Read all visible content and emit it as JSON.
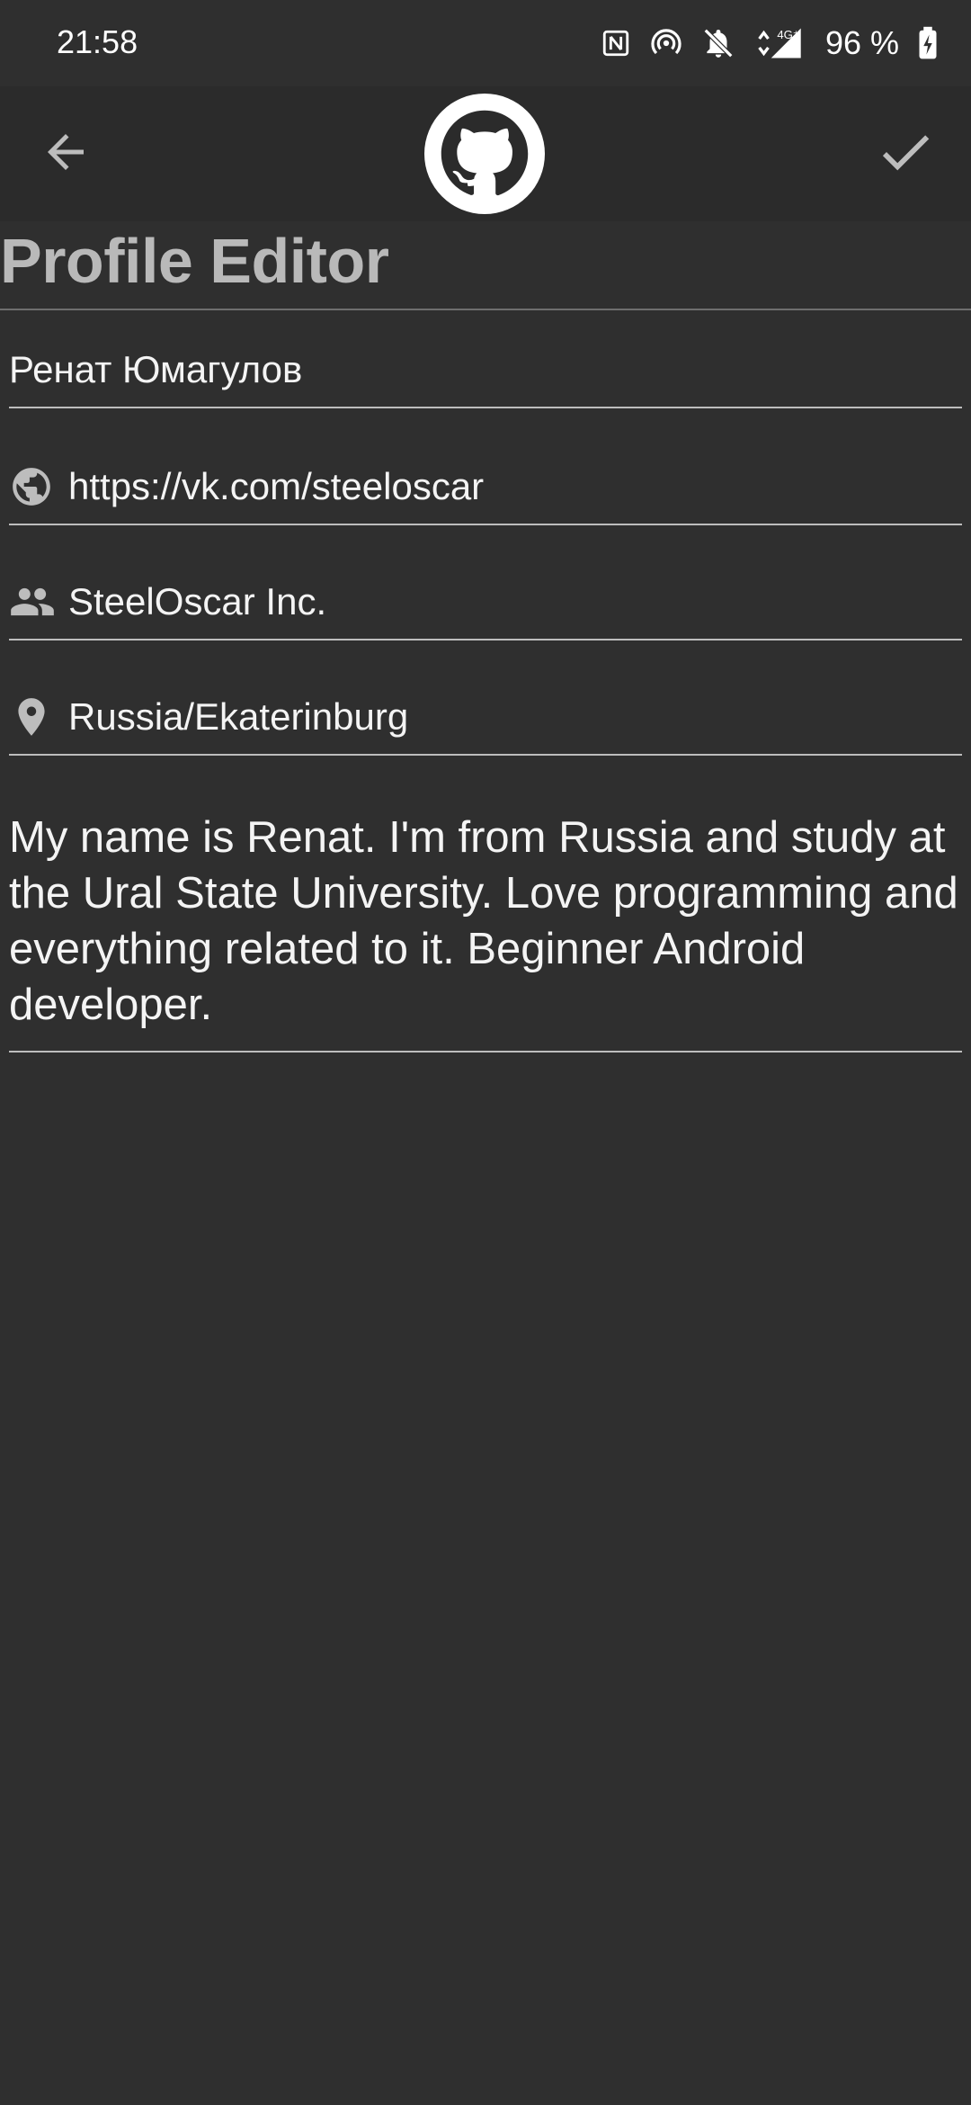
{
  "status_bar": {
    "time": "21:58",
    "network": "4G⁺",
    "battery_percent": "96 %",
    "icons": [
      "nfc-icon",
      "hotspot-icon",
      "bell-off-icon",
      "data-arrows-icon",
      "signal-icon",
      "battery-charging-icon"
    ]
  },
  "app_bar": {
    "back_icon": "arrow-back-icon",
    "logo": "github-octocat-logo",
    "confirm_icon": "check-icon"
  },
  "page": {
    "title": "Profile Editor"
  },
  "form": {
    "name": {
      "value": "Ренат Юмагулов"
    },
    "blog": {
      "icon": "globe-icon",
      "value": "https://vk.com/steeloscar"
    },
    "company": {
      "icon": "people-icon",
      "value": "SteelOscar Inc."
    },
    "location": {
      "icon": "location-pin-icon",
      "value": "Russia/Ekaterinburg"
    },
    "bio": {
      "value": "My name is Renat. I'm from Russia and study at the Ural State University. Love programming and everything related to it. Beginner Android developer."
    }
  },
  "colors": {
    "background": "#2f2f2f",
    "app_bar": "#2b2b2b",
    "title_text": "#b9b9b9",
    "icon_tint": "#bdbdbd",
    "field_text": "#f4f4f4"
  }
}
